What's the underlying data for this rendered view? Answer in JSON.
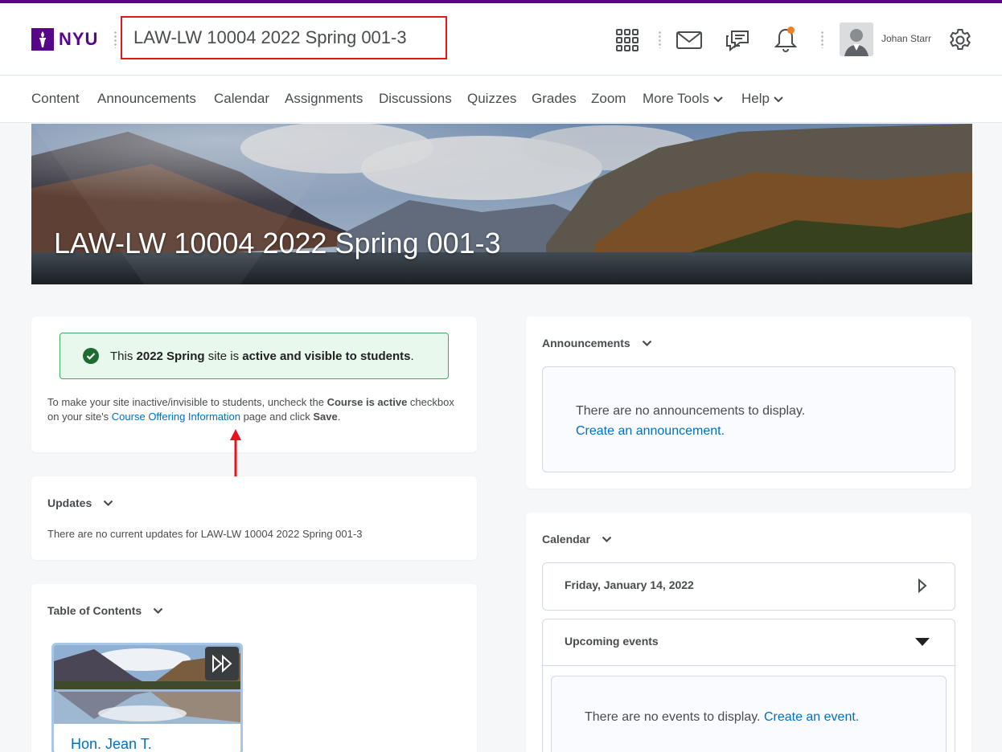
{
  "header": {
    "logo_text": "NYU",
    "course_title": "LAW-LW 10004 2022 Spring 001-3",
    "user_name": "Johan Starr",
    "icons": [
      "waffle-icon",
      "mail-icon",
      "chat-icon",
      "bell-icon",
      "gear-icon"
    ],
    "notification_dot_color": "#f08020"
  },
  "nav": {
    "items": [
      "Content",
      "Announcements",
      "Calendar",
      "Assignments",
      "Discussions",
      "Quizzes",
      "Grades",
      "Zoom",
      "More Tools",
      "Help"
    ]
  },
  "banner": {
    "title": "LAW-LW 10004 2022 Spring 001-3"
  },
  "status_card": {
    "alert_prefix": "This ",
    "alert_term": "2022 Spring",
    "alert_mid": " site is ",
    "alert_state": "active and visible to students",
    "alert_end": ".",
    "info_1": "To make your site inactive/invisible to students, uncheck the ",
    "info_bold_1": "Course is active",
    "info_2": " checkbox on your site's ",
    "info_link": "Course Offering Information",
    "info_3": " page and click ",
    "info_bold_2": "Save",
    "info_4": "."
  },
  "updates": {
    "title": "Updates",
    "message": "There are no current updates for LAW-LW 10004 2022 Spring 001-3"
  },
  "toc": {
    "title": "Table of Contents",
    "item_title": "Hon. Jean T."
  },
  "announcements": {
    "title": "Announcements",
    "empty": "There are no announcements to display.",
    "create_link": "Create an announcement."
  },
  "calendar": {
    "title": "Calendar",
    "date": "Friday, January 14, 2022",
    "upcoming_title": "Upcoming events",
    "empty": "There are no events to display. ",
    "create_link": "Create an event."
  },
  "colors": {
    "brand": "#57068c",
    "link": "#006fbf",
    "success_border": "#46a661",
    "annotation": "#e5141d"
  }
}
